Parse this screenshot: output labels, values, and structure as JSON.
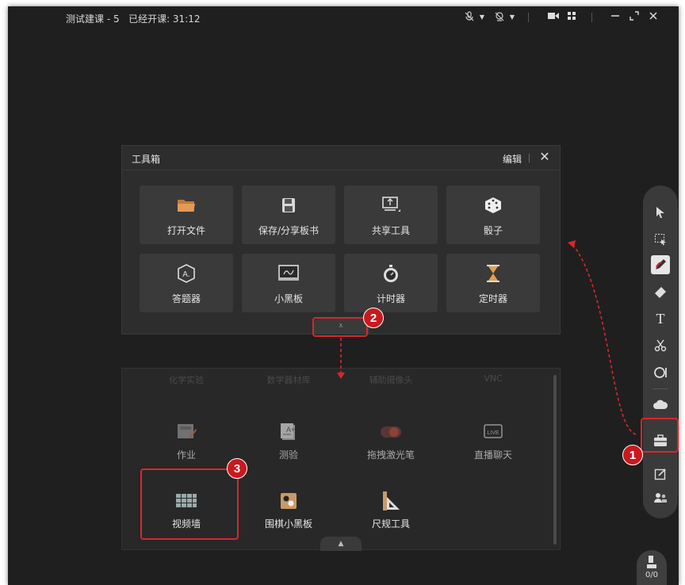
{
  "window": {
    "title": "测试建课 - 5",
    "session_status": "已经开课: 31:12"
  },
  "toolbox": {
    "title": "工具箱",
    "edit_label": "编辑",
    "close_symbol": "✕",
    "tools": [
      {
        "label": "打开文件",
        "icon": "folder-icon"
      },
      {
        "label": "保存/分享板书",
        "icon": "save-icon"
      },
      {
        "label": "共享工具",
        "icon": "screen-share-icon"
      },
      {
        "label": "骰子",
        "icon": "dice-icon"
      },
      {
        "label": "答题器",
        "icon": "answer-hex-icon"
      },
      {
        "label": "小黑板",
        "icon": "blackboard-icon"
      },
      {
        "label": "计时器",
        "icon": "stopwatch-icon"
      },
      {
        "label": "定时器",
        "icon": "hourglass-icon"
      }
    ],
    "expand_symbol": "⩡"
  },
  "more_tools": {
    "faded_labels": [
      "化学实验",
      "数学器材库",
      "辅助摄像头",
      "VNC"
    ],
    "tools": [
      {
        "label": "作业",
        "icon": "homework-icon"
      },
      {
        "label": "测验",
        "icon": "quiz-icon"
      },
      {
        "label": "拖拽激光笔",
        "icon": "laser-pointer-icon"
      },
      {
        "label": "直播聊天",
        "icon": "live-chat-icon"
      },
      {
        "label": "视频墙",
        "icon": "video-wall-icon"
      },
      {
        "label": "围棋小黑板",
        "icon": "go-board-icon"
      },
      {
        "label": "尺规工具",
        "icon": "ruler-icon"
      }
    ],
    "collapse_symbol": "▲"
  },
  "annotations": [
    "1",
    "2",
    "3"
  ],
  "right_toolbar": [
    {
      "name": "select-arrow-icon"
    },
    {
      "name": "region-select-icon"
    },
    {
      "name": "pen-icon"
    },
    {
      "name": "eraser-icon"
    },
    {
      "name": "text-icon"
    },
    {
      "name": "scissors-icon"
    },
    {
      "name": "shape-icon"
    },
    {
      "name": "cloud-icon"
    },
    {
      "name": "toolbox-icon"
    },
    {
      "name": "edit-note-icon"
    },
    {
      "name": "users-icon"
    }
  ],
  "participant_count": "0/0",
  "colors": {
    "accent_red": "#d9262c",
    "background": "#1f1f1f"
  }
}
